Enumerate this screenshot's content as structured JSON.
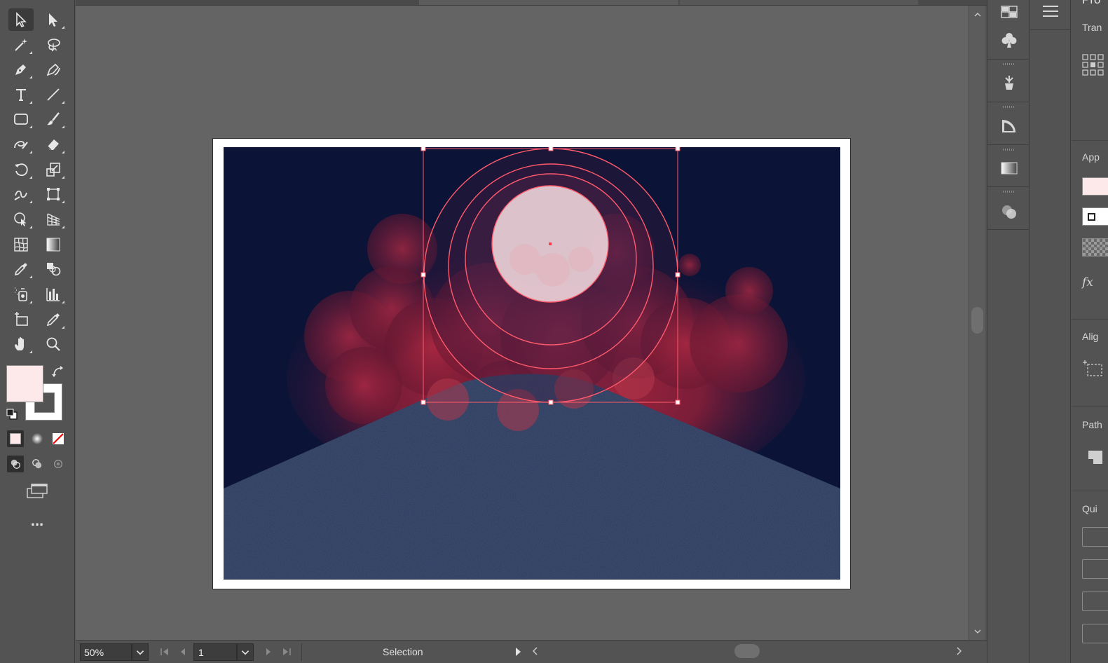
{
  "status": {
    "zoom_value": "50%",
    "page_value": "1",
    "current_tool": "Selection"
  },
  "properties_panel": {
    "title_partial": "Pro",
    "transform_partial": "Tran",
    "appearance_partial": "App",
    "fx_label": "fx",
    "align_partial": "Alig",
    "pathfinder_partial": "Path",
    "quick_actions_partial": "Qui"
  },
  "toolbar": {
    "more_label": "...",
    "fill_color": "#fde9ea",
    "stroke_color": "#ffffff"
  },
  "colors": {
    "ui_bg": "#535353",
    "canvas_bg": "#646464",
    "night_sky": "#0b1437",
    "mountain": "#2b3a5c",
    "selection": "#ff4d5e"
  }
}
